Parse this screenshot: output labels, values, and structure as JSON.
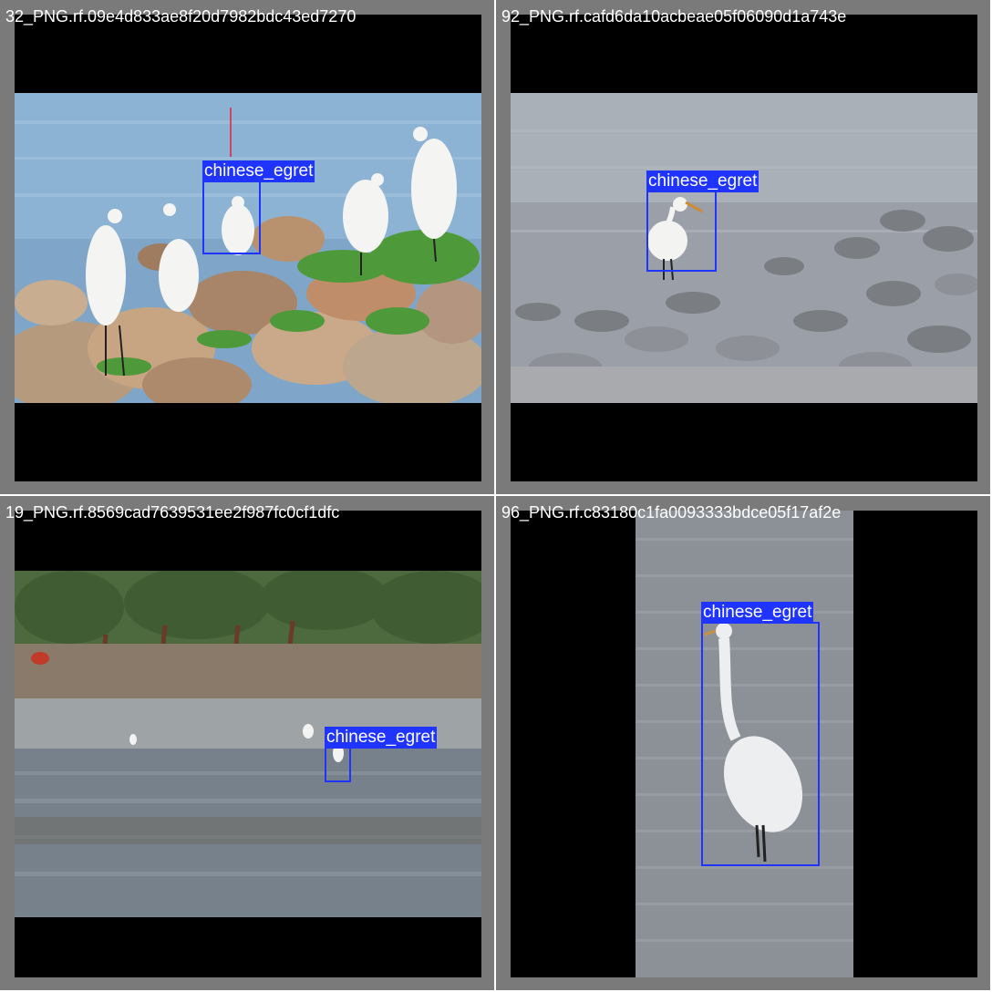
{
  "tiles": [
    {
      "filename": "32_PNG.rf.09e4d833ae8f20d7982bdc43ed7270",
      "scene_description_icon": "egrets-on-rocks-photo",
      "detections": [
        {
          "label": "chinese_egret"
        }
      ]
    },
    {
      "filename": "92_PNG.rf.cafd6da10acbeae05f06090d1a743e",
      "scene_description_icon": "egret-on-pebble-shore-photo",
      "detections": [
        {
          "label": "chinese_egret"
        }
      ]
    },
    {
      "filename": "19_PNG.rf.8569cad7639531ee2f987fc0cf1dfc",
      "scene_description_icon": "egrets-on-mudflat-photo",
      "detections": [
        {
          "label": "chinese_egret"
        }
      ]
    },
    {
      "filename": "96_PNG.rf.c83180c1fa0093333bdce05f17af2e",
      "scene_description_icon": "egret-standing-in-water-photo",
      "detections": [
        {
          "label": "chinese_egret"
        }
      ]
    }
  ],
  "colors": {
    "tile_background": "#7a7a7a",
    "letterbox": "#000000",
    "bbox": "#1f35ff",
    "label_text": "#ffffff"
  }
}
